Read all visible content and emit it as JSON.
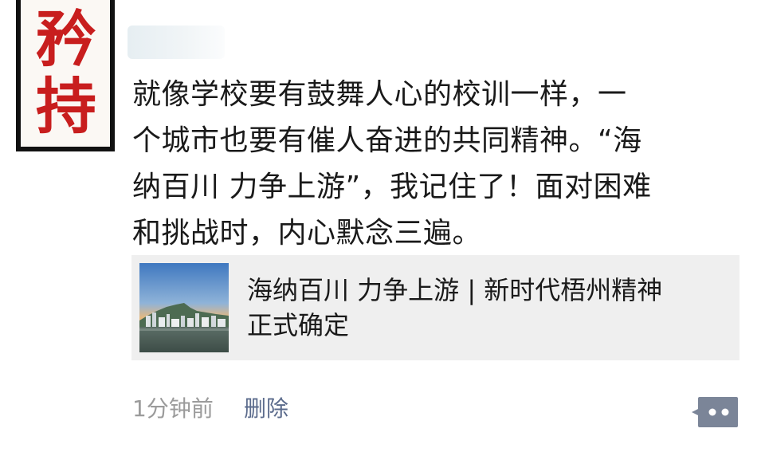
{
  "avatar": {
    "char_1": "矜",
    "char_2": "持"
  },
  "post": {
    "lines": [
      "就像学校要有鼓舞人心的校训一样，一",
      "个城市也要有催人奋进的共同精神。“海",
      "纳百川 力争上游”，我记住了！面对困难",
      "和挑战时，内心默念三遍。"
    ]
  },
  "link_card": {
    "title_line_1": "海纳百川 力争上游 | 新时代梧州精神",
    "title_line_2": "正式确定"
  },
  "footer": {
    "timestamp": "1分钟前",
    "delete_label": "删除"
  },
  "colors": {
    "avatar_text": "#c81e1e",
    "link_blue": "#5b6b8c",
    "muted_gray": "#9b9b9b",
    "card_bg": "#efefef",
    "comment_button_bg": "#7b8598"
  },
  "icons": {
    "comment": "comment-bubble-icon"
  }
}
